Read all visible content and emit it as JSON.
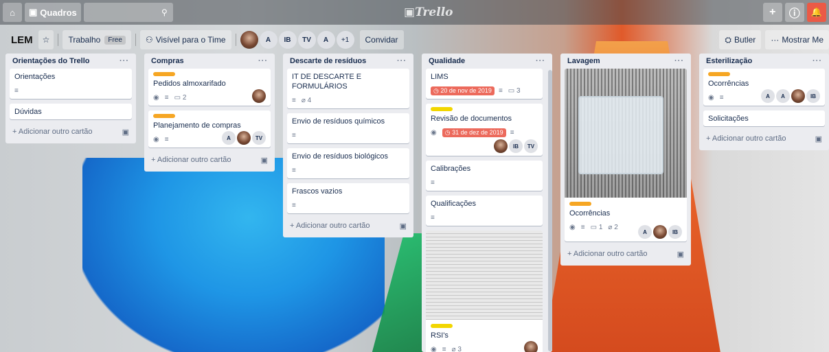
{
  "topbar": {
    "home_icon": "home-icon",
    "boards_label": "Quadros",
    "logo": "Trello",
    "right_icons": [
      "plus-icon",
      "info-icon",
      "bell-icon"
    ]
  },
  "board": {
    "title": "LEM",
    "team_label": "Trabalho",
    "team_badge": "Free",
    "visibility_label": "Visível para o Time",
    "members": [
      "A",
      "IB",
      "TV",
      "A"
    ],
    "more_members": "+1",
    "invite_label": "Convidar",
    "butler_label": "Butler",
    "show_menu_label": "Mostrar Me"
  },
  "lists": [
    {
      "title": "Orientações do Trello",
      "cards": [
        {
          "title": "Orientações",
          "badges": [
            "description"
          ]
        },
        {
          "title": "Dúvidas"
        }
      ],
      "add_label": "Adicionar outro cartão"
    },
    {
      "title": "Compras",
      "cards": [
        {
          "title": "Pedidos almoxarifado",
          "label": "#f6a623",
          "comments": "2"
        },
        {
          "title": "Planejamento de compras",
          "label": "#f6a623",
          "members": [
            "A",
            "TV"
          ]
        }
      ],
      "add_label": "Adicionar outro cartão"
    },
    {
      "title": "Descarte de resíduos",
      "cards": [
        {
          "title": "IT DE DESCARTE E FORMULÁRIOS",
          "attachments": "4"
        },
        {
          "title": "Envio de resíduos químicos"
        },
        {
          "title": "Envio de resíduos biológicos"
        },
        {
          "title": "Frascos vazios"
        }
      ],
      "add_label": "Adicionar outro cartão"
    },
    {
      "title": "Qualidade",
      "cards": [
        {
          "title": "LIMS",
          "due": "20 de nov de 2019",
          "comments": "3"
        },
        {
          "title": "Revisão de documentos",
          "label": "#f2d600",
          "due": "31 de dez de 2019",
          "members": [
            "IB",
            "TV"
          ]
        },
        {
          "title": "Calibrações"
        },
        {
          "title": "Qualificações"
        },
        {
          "title": "RSI's",
          "label": "#f2d600",
          "attachments": "3"
        }
      ]
    },
    {
      "title": "Lavagem",
      "cards": [
        {
          "title": "Ocorrências",
          "label": "#f6a623",
          "comments": "1",
          "attachments": "2",
          "members": [
            "A",
            "IB"
          ]
        }
      ],
      "add_label": "Adicionar outro cartão"
    },
    {
      "title": "Esterilização",
      "cards": [
        {
          "title": "Ocorrências",
          "label": "#f6a623",
          "members": [
            "A",
            "A",
            "IB"
          ]
        },
        {
          "title": "Solicitações"
        }
      ],
      "add_label": "Adicionar outro cartão"
    }
  ],
  "icons": {
    "plus": "+",
    "info": "ⓘ",
    "bell": "🔔",
    "eye": "◉",
    "desc": "≡",
    "comment": "▭",
    "clip": "⌀",
    "clock": "◷",
    "star": "☆",
    "search": "⚲",
    "card_template": "▣"
  },
  "colors": {
    "due_red": "#ec6a5c",
    "label_orange": "#f6a623",
    "label_yellow": "#f2d600"
  }
}
